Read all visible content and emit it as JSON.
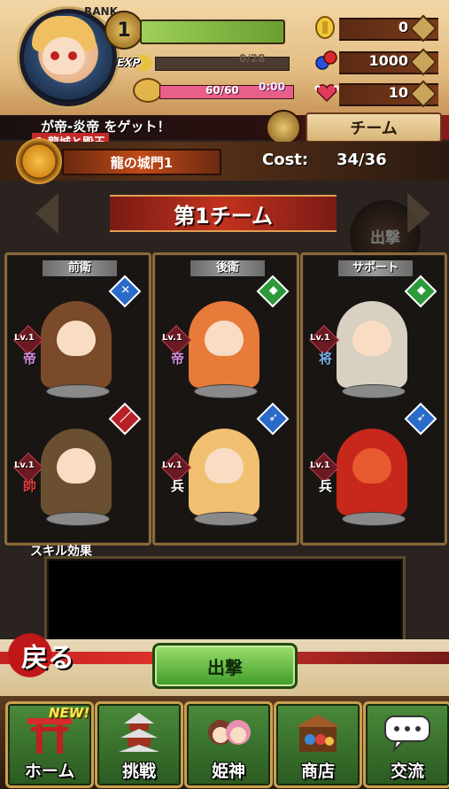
{
  "hud": {
    "rank_label": "RANK",
    "rank_value": "1",
    "exp_label": "EXP",
    "exp_value": "0/28",
    "exp_fraction": 0.0,
    "stamina_value": "60/60",
    "stamina_fraction": 1.0,
    "stamina_timer": "0:00",
    "gold": "0",
    "gems": "1000",
    "hearts": "10"
  },
  "notice": {
    "text": "が帝-炎帝 をゲット！",
    "sub": "1.龍城と殿王"
  },
  "team_tab": {
    "label": "チーム"
  },
  "castle": {
    "name": "龍の城門1",
    "cost_label": "Cost:",
    "cost_value": "34/36"
  },
  "team_banner": {
    "title": "第1チーム"
  },
  "background_button": {
    "label": "出撃"
  },
  "columns": [
    {
      "header": "前衛",
      "slots": [
        {
          "level": "Lv.1",
          "rank": "帝",
          "type_icon": "sword-icon",
          "type_color": "#2a6ac8",
          "type_glyph": "✕"
        },
        {
          "level": "Lv.1",
          "rank": "帥",
          "type_icon": "spear-icon",
          "type_color": "#b82028",
          "type_glyph": "／"
        }
      ]
    },
    {
      "header": "後衛",
      "slots": [
        {
          "level": "Lv.1",
          "rank": "帝",
          "type_icon": "shield-icon",
          "type_color": "#2a9a3a",
          "type_glyph": "◆"
        },
        {
          "level": "Lv.1",
          "rank": "兵",
          "type_icon": "bow-icon",
          "type_color": "#2a6ac8",
          "type_glyph": "➶"
        }
      ]
    },
    {
      "header": "サポート",
      "slots": [
        {
          "level": "Lv.1",
          "rank": "将",
          "type_icon": "shield-icon",
          "type_color": "#2a9a3a",
          "type_glyph": "◆"
        },
        {
          "level": "Lv.1",
          "rank": "兵",
          "type_icon": "bow-icon",
          "type_color": "#2a6ac8",
          "type_glyph": "➶"
        }
      ]
    }
  ],
  "skill": {
    "label": "スキル効果"
  },
  "actions": {
    "back_label": "戻る",
    "sortie_label": "出撃"
  },
  "nav": {
    "new_badge": "NEW!",
    "items": [
      {
        "label": "ホーム",
        "icon": "torii-icon"
      },
      {
        "label": "挑戦",
        "icon": "pagoda-icon"
      },
      {
        "label": "姫神",
        "icon": "princess-icon"
      },
      {
        "label": "商店",
        "icon": "shop-icon"
      },
      {
        "label": "交流",
        "icon": "chat-icon"
      }
    ]
  },
  "colors": {
    "accent_red": "#c2321e",
    "accent_green": "#3e9a2a",
    "frame_gold": "#c9a050"
  }
}
